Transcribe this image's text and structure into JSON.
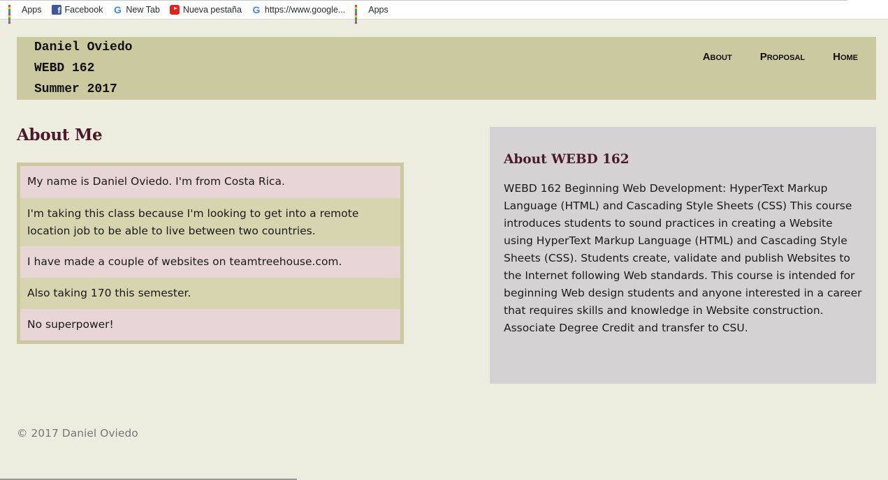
{
  "bookmarks": [
    {
      "icon": "apps-icon",
      "label": "Apps"
    },
    {
      "icon": "facebook-icon",
      "label": "Facebook"
    },
    {
      "icon": "google-icon",
      "label": "New Tab"
    },
    {
      "icon": "youtube-icon",
      "label": "Nueva pestaña"
    },
    {
      "icon": "google-icon",
      "label": "https://www.google..."
    },
    {
      "icon": "apps-icon",
      "label": "Apps"
    }
  ],
  "header": {
    "name": "Daniel Oviedo",
    "course": "WEBD 162",
    "term": "Summer 2017",
    "nav": [
      "About",
      "Proposal",
      "Home"
    ]
  },
  "main": {
    "title": "About Me",
    "facts": [
      "My name is Daniel Oviedo. I'm from Costa Rica.",
      "I'm taking this class because I'm looking to get into a remote location job to be able to live between two countries.",
      "I have made a couple of websites on teamtreehouse.com.",
      "Also taking 170 this semester.",
      "No superpower!"
    ]
  },
  "aside": {
    "title": "About WEBD 162",
    "body": "WEBD 162 Beginning Web Development: HyperText Markup Language (HTML) and Cascading Style Sheets (CSS) This course introduces students to sound practices in creating a Website using HyperText Markup Language (HTML) and Cascading Style Sheets (CSS). Students create, validate and publish Websites to the Internet following Web standards. This course is intended for beginning Web design students and anyone interested in a career that requires skills and knowledge in Website construction. Associate Degree Credit and transfer to CSU."
  },
  "footer": {
    "copyright": "© 2017 Daniel Oviedo"
  },
  "colors": {
    "page_bg": "#eceddf",
    "header_bg": "#cbc99f",
    "heading": "#4a1a2a",
    "fact_pink": "#e8d6d6",
    "fact_olive": "#d6d5b0",
    "aside_bg": "#d4d2d2"
  }
}
